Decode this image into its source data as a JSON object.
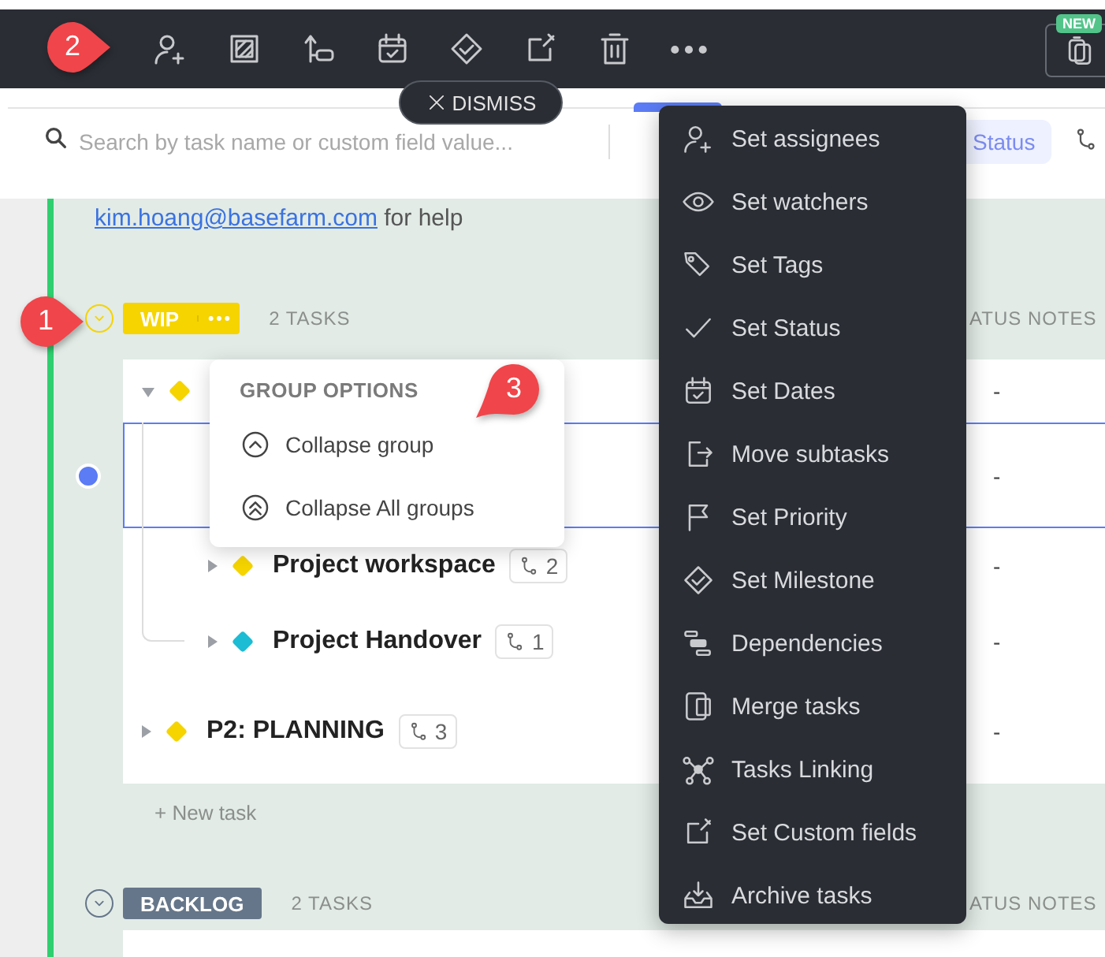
{
  "toolbar": {
    "callout": "2",
    "new_badge": "NEW"
  },
  "dismiss": "DISMISS",
  "search": {
    "placeholder": "Search by task name or custom field value..."
  },
  "filter_chip": "Status",
  "help_text": {
    "email": "kim.hoang@basefarm.com",
    "rest": "for help"
  },
  "groups": [
    {
      "name": "WIP",
      "color": "#f5d400",
      "count": "2 TASKS",
      "column": "ATUS NOTES",
      "callout": "1",
      "new_task": "+ New task",
      "tasks": [
        {
          "color": "#f5d400",
          "notes": "-",
          "expanded": true,
          "selected": false,
          "children": [
            {
              "selected": true,
              "notes": "-"
            },
            {
              "name": "Project workspace",
              "color": "#f5d400",
              "subtasks": "2",
              "notes": "-",
              "expanded": false,
              "selected": false
            },
            {
              "name": "Project Handover",
              "color": "#1bbcd4",
              "subtasks": "1",
              "notes": "-",
              "expanded": false,
              "selected": false
            }
          ]
        },
        {
          "name": "P2: PLANNING",
          "color": "#f5d400",
          "subtasks": "3",
          "notes": "-",
          "expanded": false,
          "selected": false
        }
      ]
    },
    {
      "name": "BACKLOG",
      "color": "#66768a",
      "count": "2 TASKS",
      "column": "ATUS NOTES"
    }
  ],
  "group_options": {
    "title": "GROUP OPTIONS",
    "callout": "3",
    "items": [
      {
        "label": "Collapse group",
        "kind": "collapse"
      },
      {
        "label": "Collapse All groups",
        "kind": "collapse-all"
      }
    ]
  },
  "menu": [
    {
      "label": "Set assignees",
      "kind": "assignees"
    },
    {
      "label": "Set watchers",
      "kind": "watchers"
    },
    {
      "label": "Set Tags",
      "kind": "tags"
    },
    {
      "label": "Set Status",
      "kind": "status"
    },
    {
      "label": "Set Dates",
      "kind": "dates"
    },
    {
      "label": "Move subtasks",
      "kind": "move"
    },
    {
      "label": "Set Priority",
      "kind": "priority"
    },
    {
      "label": "Set Milestone",
      "kind": "milestone"
    },
    {
      "label": "Dependencies",
      "kind": "dependencies"
    },
    {
      "label": "Merge tasks",
      "kind": "merge"
    },
    {
      "label": "Tasks Linking",
      "kind": "linking"
    },
    {
      "label": "Set Custom fields",
      "kind": "custom"
    },
    {
      "label": "Archive tasks",
      "kind": "archive"
    }
  ]
}
